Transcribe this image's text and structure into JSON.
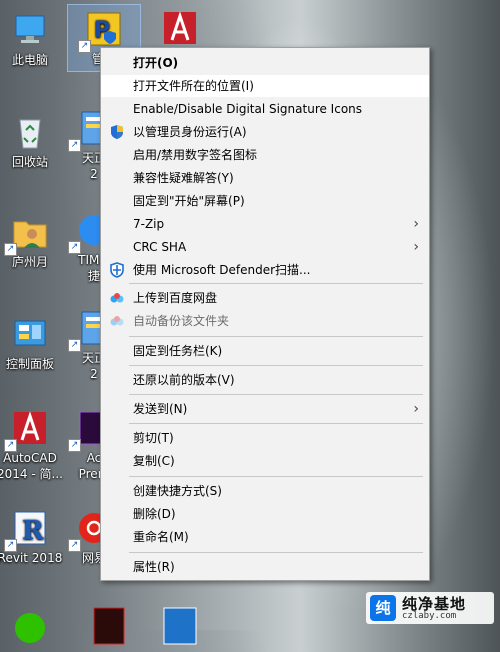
{
  "desktop": {
    "icons": [
      {
        "label": "此电脑"
      },
      {
        "label": "管立"
      },
      {
        "label": ""
      },
      {
        "label": "回收站"
      },
      {
        "label": "天正"
      },
      {
        "label": "2"
      },
      {
        "label": "庐州月"
      },
      {
        "label": "TIM.c"
      },
      {
        "label": "捷"
      },
      {
        "label": "控制面板"
      },
      {
        "label": "天正"
      },
      {
        "label": "2"
      },
      {
        "label": "AutoCAD"
      },
      {
        "label": "2014 - 简..."
      },
      {
        "label": "Ac"
      },
      {
        "label": "Prem"
      },
      {
        "label": "Revit 2018"
      },
      {
        "label": "网易"
      }
    ]
  },
  "context_menu": {
    "items": [
      {
        "label": "打开(O)"
      },
      {
        "label": "打开文件所在的位置(I)"
      },
      {
        "label": "Enable/Disable Digital Signature Icons"
      },
      {
        "label": "以管理员身份运行(A)"
      },
      {
        "label": "启用/禁用数字签名图标"
      },
      {
        "label": "兼容性疑难解答(Y)"
      },
      {
        "label": "固定到\"开始\"屏幕(P)"
      },
      {
        "label": "7-Zip"
      },
      {
        "label": "CRC SHA"
      },
      {
        "label": "使用 Microsoft Defender扫描..."
      },
      {
        "label": "上传到百度网盘"
      },
      {
        "label": "自动备份该文件夹"
      },
      {
        "label": "固定到任务栏(K)"
      },
      {
        "label": "还原以前的版本(V)"
      },
      {
        "label": "发送到(N)"
      },
      {
        "label": "剪切(T)"
      },
      {
        "label": "复制(C)"
      },
      {
        "label": "创建快捷方式(S)"
      },
      {
        "label": "删除(D)"
      },
      {
        "label": "重命名(M)"
      },
      {
        "label": "属性(R)"
      }
    ]
  },
  "watermark": {
    "logo_char": "纯",
    "title": "纯净基地",
    "url": "czlaby.com"
  },
  "colors": {
    "menu_bg": "#f2f2f2",
    "highlight": "#ffffff",
    "shield_blue": "#1f6fd6",
    "baidu_blue": "#2aa6f5"
  }
}
